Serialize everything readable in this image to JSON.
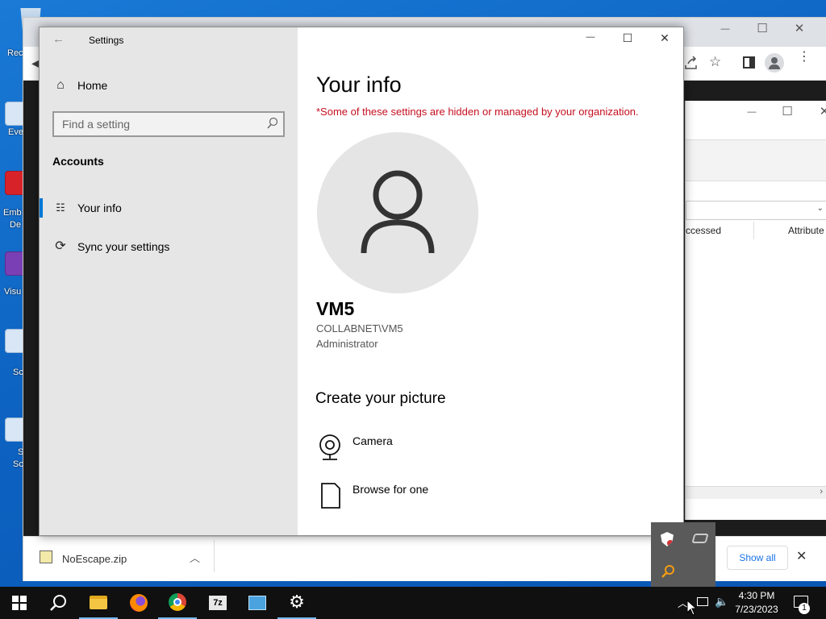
{
  "desktop": {
    "icons": [
      {
        "label": "Rec",
        "icon": "recycle-bin-icon"
      },
      {
        "label": "Eve",
        "icon": "shortcut-icon"
      },
      {
        "label": "Emb",
        "icon": "app-icon"
      },
      {
        "label": "De",
        "icon": ""
      },
      {
        "label": "Visu",
        "icon": "visual-studio-icon"
      },
      {
        "label": "Sc",
        "icon": "shortcut-icon"
      },
      {
        "label": "S",
        "icon": "shortcut-icon"
      },
      {
        "label": "Sc",
        "icon": ""
      }
    ]
  },
  "browser": {
    "window_controls": {
      "minimize": "—",
      "maximize": "☐",
      "close": "✕"
    },
    "toolbar_icons": [
      "share-icon",
      "bookmark-star-icon",
      "side-panel-icon",
      "profile-icon",
      "menu-icon"
    ],
    "download": {
      "filename": "NoEscape.zip",
      "show_all_label": "Show all",
      "close_label": "✕"
    }
  },
  "explorer": {
    "columns": [
      "ccessed",
      "Attribute"
    ]
  },
  "settings": {
    "app_title": "Settings",
    "home_label": "Home",
    "search_placeholder": "Find a setting",
    "section_heading": "Accounts",
    "nav": [
      {
        "label": "Your info",
        "icon": "person-card-icon",
        "selected": true
      },
      {
        "label": "Sync your settings",
        "icon": "sync-icon",
        "selected": false
      }
    ],
    "page_title": "Your info",
    "managed_notice": "*Some of these settings are hidden or managed by your organization.",
    "user": {
      "display_name": "VM5",
      "account": "COLLABNET\\VM5",
      "role": "Administrator"
    },
    "create_picture_heading": "Create your picture",
    "picture_options": [
      {
        "label": "Camera",
        "icon": "camera-icon"
      },
      {
        "label": "Browse for one",
        "icon": "document-icon"
      }
    ]
  },
  "taskbar": {
    "clock_time": "4:30 PM",
    "clock_date": "7/23/2023",
    "notification_count": "1",
    "apps": [
      "start-icon",
      "search-icon",
      "file-explorer-icon",
      "firefox-icon",
      "chrome-icon",
      "7zip-icon",
      "network-app-icon",
      "settings-gear-icon"
    ]
  },
  "colors": {
    "accent": "#0078d7",
    "warning_text": "#c50f1f",
    "sidebar_bg": "#e6e6e6"
  }
}
